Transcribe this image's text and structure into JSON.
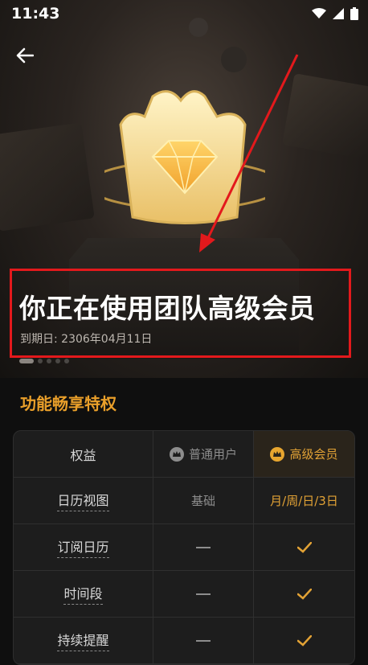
{
  "status_bar": {
    "time": "11:43",
    "icons": [
      "wifi-icon",
      "signal-icon",
      "battery-icon"
    ]
  },
  "hero": {
    "headline": "你正在使用团队高级会员",
    "expiry": "到期日: 2306年04月11日",
    "carousel_active_index": 0,
    "carousel_count": 5
  },
  "section": {
    "title": "功能畅享特权"
  },
  "table": {
    "headers": [
      "权益",
      "普通用户",
      "高级会员"
    ],
    "rows": [
      {
        "feature": "日历视图",
        "normal": "基础",
        "premium": "月/周/日/3日"
      },
      {
        "feature": "订阅日历",
        "normal": "—",
        "premium": "✓"
      },
      {
        "feature": "时间段",
        "normal": "—",
        "premium": "✓"
      },
      {
        "feature": "持续提醒",
        "normal": "—",
        "premium": "✓"
      }
    ]
  },
  "colors": {
    "accent": "#e99f2a",
    "highlight_box": "#e3191c",
    "arrow": "#e3191c"
  }
}
